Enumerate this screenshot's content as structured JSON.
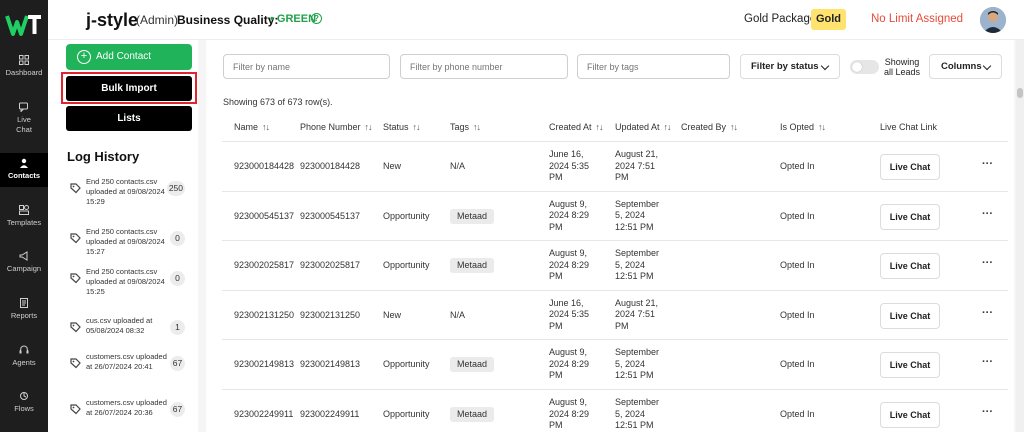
{
  "sidebar": {
    "items": [
      {
        "label": "Dashboard",
        "icon": "grid-icon"
      },
      {
        "label": "Live\nChat",
        "icon": "chat-icon"
      },
      {
        "label": "Contacts",
        "icon": "person-icon",
        "active": true
      },
      {
        "label": "Templates",
        "icon": "templates-icon"
      },
      {
        "label": "Campaign",
        "icon": "megaphone-icon"
      },
      {
        "label": "Reports",
        "icon": "reports-icon"
      },
      {
        "label": "Agents",
        "icon": "agents-icon"
      },
      {
        "label": "Flows",
        "icon": "flows-icon"
      }
    ]
  },
  "header": {
    "brand": "j-style",
    "role": "(Admin)",
    "business_quality_label": "Business Quality:",
    "business_quality_value": "• GREEN",
    "help": "?",
    "package_label": "Gold Package",
    "package_badge": "Gold",
    "limit_text": "No Limit Assigned"
  },
  "contacts_panel": {
    "add_contact": "Add Contact",
    "bulk_import": "Bulk Import",
    "lists": "Lists",
    "log_title": "Log History",
    "logs": [
      {
        "text": "End 250 contacts.csv uploaded at 09/08/2024 15:29",
        "count": "250"
      },
      {
        "text": "End 250 contacts.csv uploaded at 09/08/2024 15:27",
        "count": "0"
      },
      {
        "text": "End 250 contacts.csv uploaded at 09/08/2024 15:25",
        "count": "0"
      },
      {
        "text": "cus.csv uploaded at 05/08/2024 08:32",
        "count": "1"
      },
      {
        "text": "customers.csv uploaded at 26/07/2024 20:41",
        "count": "67"
      },
      {
        "text": "customers.csv uploaded at 26/07/2024 20:36",
        "count": "67"
      }
    ]
  },
  "filters": {
    "name_placeholder": "Filter by name",
    "phone_placeholder": "Filter by phone number",
    "tags_placeholder": "Filter by tags",
    "status_label": "Filter by status",
    "show_all_label": "Showing all Leads",
    "columns_label": "Columns"
  },
  "table": {
    "showing": "Showing 673 of 673 row(s).",
    "headers": {
      "name": "Name",
      "phone": "Phone Number",
      "status": "Status",
      "tags": "Tags",
      "created_at": "Created At",
      "updated_at": "Updated At",
      "created_by": "Created By",
      "is_opted": "Is Opted",
      "live_chat_link": "Live Chat Link"
    },
    "rows": [
      {
        "name": "923000184428",
        "phone": "923000184428",
        "status": "New",
        "tag": "N/A",
        "tag_is_pill": false,
        "created": "June 16,\n2024 5:35\nPM",
        "updated": "August 21,\n2024 7:51\nPM",
        "opted": "Opted In",
        "action": "Live Chat"
      },
      {
        "name": "923000545137",
        "phone": "923000545137",
        "status": "Opportunity",
        "tag": "Metaad",
        "tag_is_pill": true,
        "created": "August 9,\n2024 8:29\nPM",
        "updated": "September\n5, 2024\n12:51 PM",
        "opted": "Opted In",
        "action": "Live Chat"
      },
      {
        "name": "923002025817",
        "phone": "923002025817",
        "status": "Opportunity",
        "tag": "Metaad",
        "tag_is_pill": true,
        "created": "August 9,\n2024 8:29\nPM",
        "updated": "September\n5, 2024\n12:51 PM",
        "opted": "Opted In",
        "action": "Live Chat"
      },
      {
        "name": "923002131250",
        "phone": "923002131250",
        "status": "New",
        "tag": "N/A",
        "tag_is_pill": false,
        "created": "June 16,\n2024 5:35\nPM",
        "updated": "August 21,\n2024 7:51\nPM",
        "opted": "Opted In",
        "action": "Live Chat"
      },
      {
        "name": "923002149813",
        "phone": "923002149813",
        "status": "Opportunity",
        "tag": "Metaad",
        "tag_is_pill": true,
        "created": "August 9,\n2024 8:29\nPM",
        "updated": "September\n5, 2024\n12:51 PM",
        "opted": "Opted In",
        "action": "Live Chat"
      },
      {
        "name": "923002249911",
        "phone": "923002249911",
        "status": "Opportunity",
        "tag": "Metaad",
        "tag_is_pill": true,
        "created": "August 9,\n2024 8:29\nPM",
        "updated": "September\n5, 2024\n12:51 PM",
        "opted": "Opted In",
        "action": "Live Chat"
      }
    ],
    "row_menu": "···"
  },
  "colors": {
    "sidebar_bg": "#1e1e1e",
    "brand_green": "#21b35a",
    "quality_green": "#22a04b",
    "highlight_red": "#e0242b",
    "gold_badge": "#ffe36e",
    "limit_red": "#e74c3c"
  }
}
